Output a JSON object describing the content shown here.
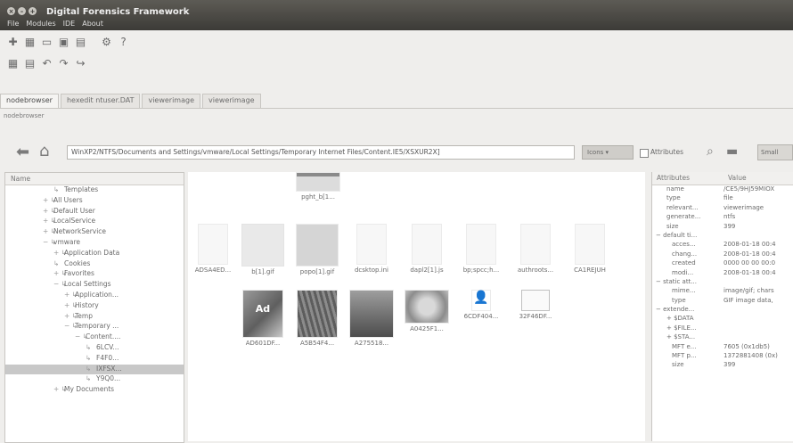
{
  "window": {
    "title": "Digital Forensics Framework"
  },
  "menu": [
    "File",
    "Modules",
    "IDE",
    "About"
  ],
  "toolbar1_icons": [
    "add-icon",
    "browser-icon",
    "open-icon",
    "monitor-icon",
    "shell-icon",
    "modules-icon",
    "help-icon"
  ],
  "toolbar2_icons": [
    "save-icon",
    "save-as-icon",
    "undo-icon",
    "redo-icon",
    "jump-icon"
  ],
  "tabs": [
    {
      "label": "nodebrowser"
    },
    {
      "label": "hexedit ntuser.DAT"
    },
    {
      "label": "viewerimage"
    },
    {
      "label": "viewerimage"
    }
  ],
  "subtitle": "nodebrowser",
  "path": "WinXP2/NTFS/Documents and Settings/vmware/Local Settings/Temporary Internet Files/Content.IE5/XSXUR2X]",
  "view_mode": "Icons",
  "attributes_label": "Attributes",
  "small_label": "Small",
  "tree": {
    "header": "Name",
    "items": [
      {
        "label": "Templates",
        "indent": 4,
        "expander": ""
      },
      {
        "label": "All Users",
        "indent": 3,
        "expander": "+"
      },
      {
        "label": "Default User",
        "indent": 3,
        "expander": "+"
      },
      {
        "label": "LocalService",
        "indent": 3,
        "expander": "+"
      },
      {
        "label": "NetworkService",
        "indent": 3,
        "expander": "+"
      },
      {
        "label": "vmware",
        "indent": 3,
        "expander": "−"
      },
      {
        "label": "Application Data",
        "indent": 4,
        "expander": "+"
      },
      {
        "label": "Cookies",
        "indent": 4,
        "expander": ""
      },
      {
        "label": "Favorites",
        "indent": 4,
        "expander": "+"
      },
      {
        "label": "Local Settings",
        "indent": 4,
        "expander": "−"
      },
      {
        "label": "Application...",
        "indent": 5,
        "expander": "+"
      },
      {
        "label": "History",
        "indent": 5,
        "expander": "+"
      },
      {
        "label": "Temp",
        "indent": 5,
        "expander": "+"
      },
      {
        "label": "Temporary ...",
        "indent": 5,
        "expander": "−"
      },
      {
        "label": "Content....",
        "indent": 6,
        "expander": "−"
      },
      {
        "label": "6LCV...",
        "indent": 7,
        "expander": ""
      },
      {
        "label": "F4F0...",
        "indent": 7,
        "expander": ""
      },
      {
        "label": "IXFSX...",
        "indent": 7,
        "expander": "",
        "selected": true
      },
      {
        "label": "Y9Q0...",
        "indent": 7,
        "expander": ""
      },
      {
        "label": "My Documents",
        "indent": 4,
        "expander": "+"
      }
    ]
  },
  "files": [
    {
      "label": "pght_b[1...",
      "kind": "strip"
    },
    {
      "label": "b[1].gif",
      "kind": "blank"
    },
    {
      "label": "popo[1].gif",
      "kind": "gray"
    },
    {
      "label": "dcsktop.ini",
      "kind": "doc"
    },
    {
      "label": "dapl2[1].js",
      "kind": "doc"
    },
    {
      "label": "bp;spcc;h...",
      "kind": "doc"
    },
    {
      "label": "authroots...",
      "kind": "doc"
    },
    {
      "label": "CA1REJUH",
      "kind": "doc"
    },
    {
      "label": "ADSA4ED...",
      "kind": "doc"
    },
    {
      "label": "AD601DF...",
      "kind": "ad"
    },
    {
      "label": "A5B54F4...",
      "kind": "grass"
    },
    {
      "label": "A275518...",
      "kind": "photo1"
    },
    {
      "label": "A0425F1...",
      "kind": "plate"
    },
    {
      "label": "6CDF404...",
      "kind": "user"
    },
    {
      "label": "32F46DF...",
      "kind": "screen"
    }
  ],
  "attributes": {
    "col_attr": "Attributes",
    "col_value": "Value",
    "rows": [
      {
        "key": "name",
        "value": "/CE5/9HJ59MIOX",
        "indent": 2
      },
      {
        "key": "type",
        "value": "file",
        "indent": 2
      },
      {
        "key": "relevant...",
        "value": "viewerimage",
        "indent": 2
      },
      {
        "key": "generate...",
        "value": "ntfs",
        "indent": 2
      },
      {
        "key": "size",
        "value": "399",
        "indent": 2
      },
      {
        "key": "− default ti...",
        "value": "",
        "indent": 0
      },
      {
        "key": "acces...",
        "value": "2008-01-18 00:4",
        "indent": 3
      },
      {
        "key": "chang...",
        "value": "2008-01-18 00:4",
        "indent": 3
      },
      {
        "key": "created",
        "value": "0000 00 00 00:0",
        "indent": 3
      },
      {
        "key": "modi...",
        "value": "2008-01-18 00:4",
        "indent": 3
      },
      {
        "key": "− static att...",
        "value": "",
        "indent": 0
      },
      {
        "key": "mime...",
        "value": "image/gif; chars",
        "indent": 3
      },
      {
        "key": "type",
        "value": "GIF image data,",
        "indent": 3
      },
      {
        "key": "− extende...",
        "value": "",
        "indent": 0
      },
      {
        "key": "+ $DATA",
        "value": "",
        "indent": 2
      },
      {
        "key": "+ $FILE...",
        "value": "",
        "indent": 2
      },
      {
        "key": "+ $STA...",
        "value": "",
        "indent": 2
      },
      {
        "key": "MFT e...",
        "value": "7605 (0x1db5)",
        "indent": 3
      },
      {
        "key": "MFT p...",
        "value": "1372881408 (0x)",
        "indent": 3
      },
      {
        "key": "size",
        "value": "399",
        "indent": 3
      }
    ]
  }
}
